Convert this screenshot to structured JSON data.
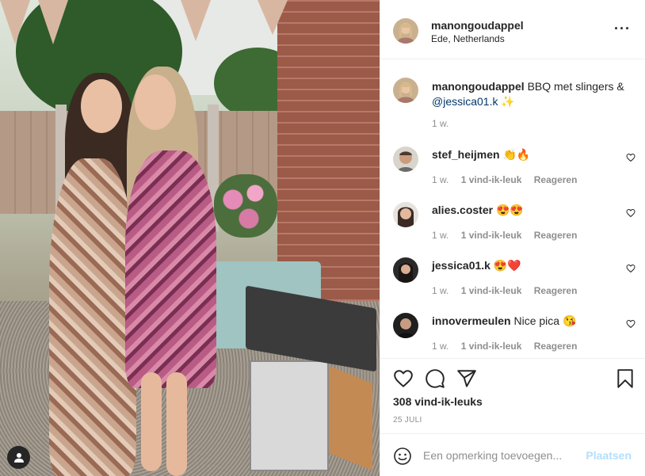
{
  "post": {
    "username": "manongoudappel",
    "location": "Ede, Netherlands",
    "more_icon": "more-horizontal-icon"
  },
  "caption": {
    "username": "manongoudappel",
    "text": "BBQ met slingers &",
    "mention": "@jessica01.k",
    "emoji": "✨",
    "time": "1 w."
  },
  "comments": [
    {
      "username": "stef_heijmen",
      "text": "👏🔥",
      "time": "1 w.",
      "likes": "1 vind-ik-leuk",
      "reply": "Reageren"
    },
    {
      "username": "alies.coster",
      "text": "😍😍",
      "time": "1 w.",
      "likes": "1 vind-ik-leuk",
      "reply": "Reageren"
    },
    {
      "username": "jessica01.k",
      "text": "😍❤️",
      "time": "1 w.",
      "likes": "1 vind-ik-leuk",
      "reply": "Reageren"
    },
    {
      "username": "innovermeulen",
      "text": "Nice pica 😘",
      "time": "1 w.",
      "likes": "1 vind-ik-leuk",
      "reply": "Reageren"
    }
  ],
  "actions": {
    "likes_count": "308 vind-ik-leuks",
    "date": "25 JULI"
  },
  "add_comment": {
    "placeholder": "Een opmerking toevoegen...",
    "post_label": "Plaatsen"
  },
  "colors": {
    "text": "#262626",
    "secondary": "#8e8e8e",
    "link": "#00376b",
    "post_disabled": "#b2dffc"
  }
}
